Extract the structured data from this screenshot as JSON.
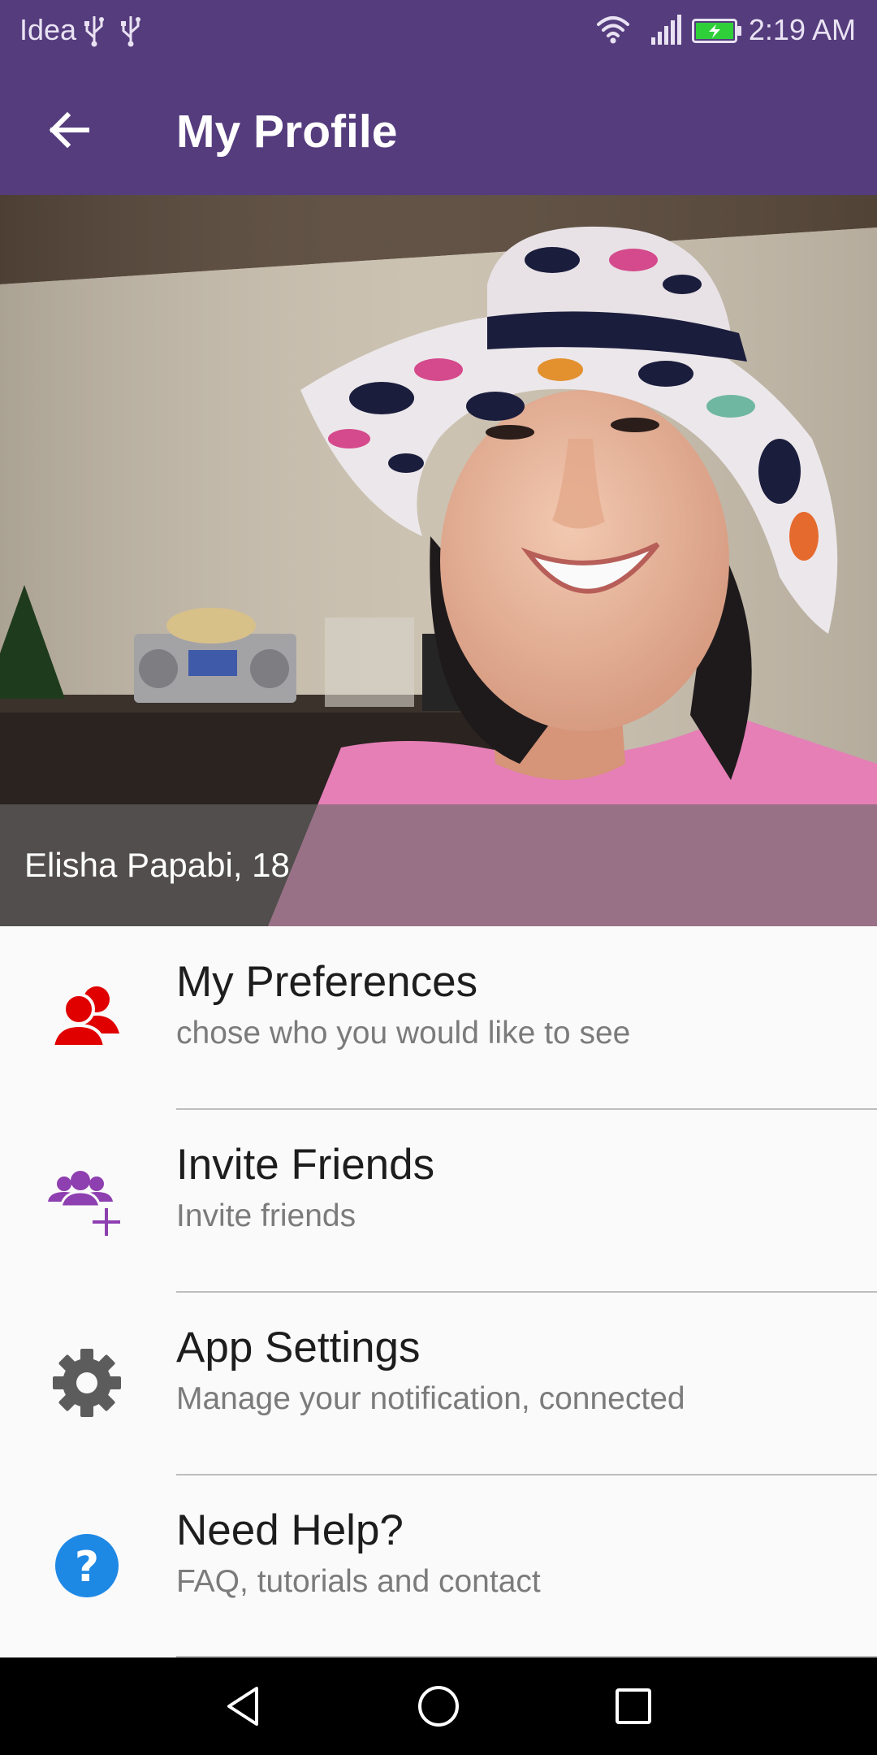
{
  "status_bar": {
    "carrier": "Idea",
    "time": "2:19 AM",
    "icons": [
      "usb-icon",
      "usb-icon",
      "wifi-icon",
      "cell-signal-icon",
      "battery-charging-icon"
    ]
  },
  "app_bar": {
    "back_icon": "arrow-back-icon",
    "title": "My Profile"
  },
  "profile": {
    "name_age": "Elisha Papabi, 18"
  },
  "menu": {
    "items": [
      {
        "title": "My Preferences",
        "subtitle": "chose who you would like to see",
        "icon": "users-icon",
        "icon_color": "#e00000"
      },
      {
        "title": "Invite Friends",
        "subtitle": "Invite friends",
        "icon": "invite-friends-icon",
        "icon_color": "#8e3fb0"
      },
      {
        "title": "App Settings",
        "subtitle": "Manage your notification, connected",
        "icon": "gear-icon",
        "icon_color": "#5c5c5c"
      },
      {
        "title": "Need Help?",
        "subtitle": "FAQ, tutorials and contact",
        "icon": "help-icon",
        "icon_color": "#1e88e5"
      }
    ]
  },
  "nav_bar": {
    "icons": [
      "nav-back-icon",
      "nav-home-icon",
      "nav-recents-icon"
    ]
  },
  "colors": {
    "primary": "#553c7d",
    "background": "#fafafa",
    "overlay": "#6e6e6e"
  }
}
